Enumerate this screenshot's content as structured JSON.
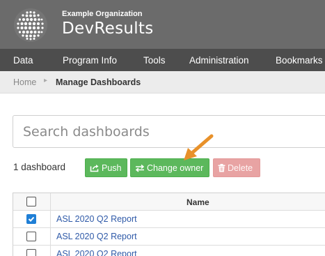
{
  "header": {
    "org_name": "Example Organization",
    "app_name": "DevResults"
  },
  "nav": {
    "items": [
      {
        "label": "Data"
      },
      {
        "label": "Program Info"
      },
      {
        "label": "Tools"
      },
      {
        "label": "Administration"
      },
      {
        "label": "Bookmarks"
      }
    ]
  },
  "breadcrumb": {
    "home": "Home",
    "separator": "▸",
    "current": "Manage Dashboards"
  },
  "search": {
    "placeholder": "Search dashboards",
    "value": ""
  },
  "toolbar": {
    "count_label": "1 dashboard",
    "push_label": "Push",
    "change_owner_label": "Change owner",
    "delete_label": "Delete"
  },
  "table": {
    "header_name": "Name",
    "rows": [
      {
        "name": "ASL 2020 Q2 Report",
        "checked": true
      },
      {
        "name": "ASL 2020 Q2 Report",
        "checked": false
      },
      {
        "name": "ASL 2020 Q2 Report",
        "checked": false
      }
    ]
  },
  "colors": {
    "header_bg": "#6b6b6b",
    "nav_bg": "#4d4d4d",
    "success": "#5cb85c",
    "danger_disabled": "#e8a3a3",
    "link": "#2f5aa8",
    "checkbox_checked": "#1f7fd6",
    "annotation_arrow": "#e8912a"
  }
}
